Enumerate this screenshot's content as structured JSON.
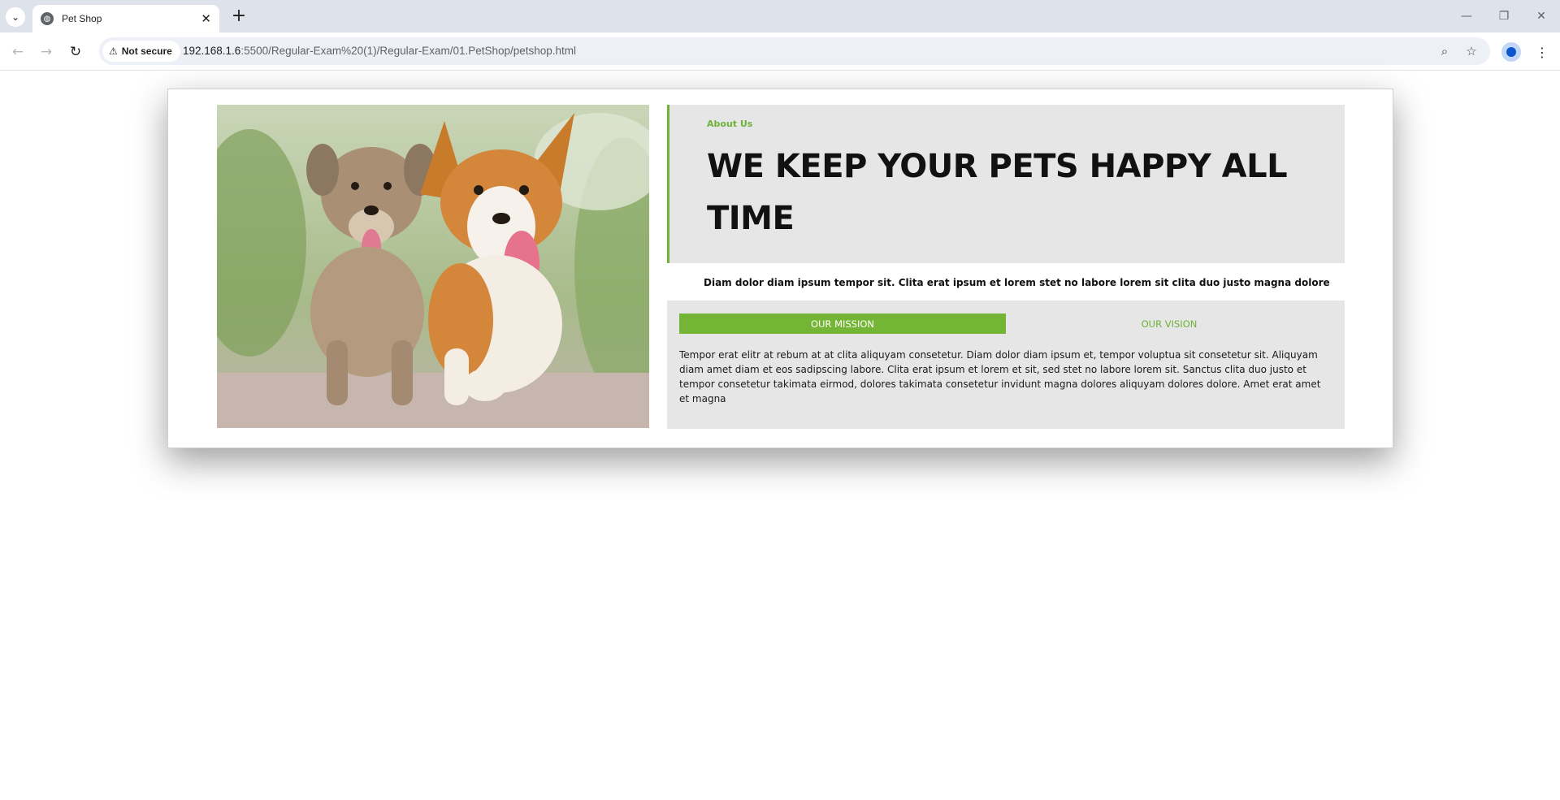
{
  "browser": {
    "tab_title": "Pet Shop",
    "security_label": "Not secure",
    "url_host": "192.168.1.6",
    "url_path": ":5500/Regular-Exam%20(1)/Regular-Exam/01.PetShop/petshop.html"
  },
  "page": {
    "about_label": "About Us",
    "heading": "WE KEEP YOUR PETS HAPPY ALL TIME",
    "lead": "Diam dolor diam ipsum tempor sit. Clita erat ipsum et lorem stet no labore lorem sit clita duo justo magna dolore",
    "tabs": [
      {
        "label": "OUR MISSION",
        "active": true
      },
      {
        "label": "OUR VISION",
        "active": false
      }
    ],
    "tab_text": "Tempor erat elitr at rebum at at clita aliquyam consetetur. Diam dolor diam ipsum et, tempor voluptua sit consetetur sit. Aliquyam diam amet diam et eos sadipscing labore. Clita erat ipsum et lorem et sit, sed stet no labore lorem sit. Sanctus clita duo justo et tempor consetetur takimata eirmod, dolores takimata consetetur invidunt magna dolores aliquyam dolores dolore. Amet erat amet et magna"
  },
  "colors": {
    "accent": "#75b535",
    "panel_bg": "#e6e6e6"
  }
}
